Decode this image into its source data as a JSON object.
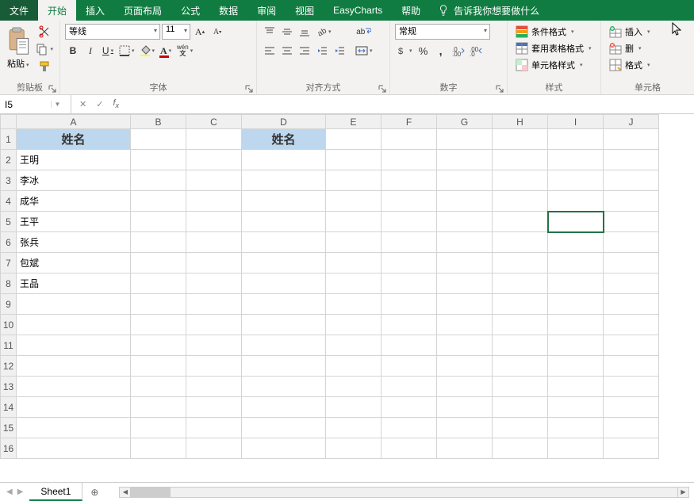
{
  "menu": {
    "file": "文件",
    "home": "开始",
    "insert": "插入",
    "layout": "页面布局",
    "formulas": "公式",
    "data": "数据",
    "review": "审阅",
    "view": "视图",
    "easycharts": "EasyCharts",
    "help": "帮助",
    "tellme": "告诉我你想要做什么"
  },
  "ribbon": {
    "clipboard": {
      "paste": "粘贴",
      "label": "剪贴板"
    },
    "font": {
      "name": "等线",
      "size": "11",
      "label": "字体",
      "bold": "B",
      "italic": "I",
      "underline": "U",
      "pinyin": "wén"
    },
    "align": {
      "label": "对齐方式",
      "wrap": "ab"
    },
    "number": {
      "format": "常规",
      "label": "数字"
    },
    "styles": {
      "cond": "条件格式",
      "table": "套用表格格式",
      "cell": "单元格样式",
      "label": "样式"
    },
    "cells": {
      "insert": "插入",
      "delete": "删",
      "format": "格式",
      "label": "单元格"
    }
  },
  "formula_bar": {
    "name": "I5",
    "value": ""
  },
  "columns": [
    "A",
    "B",
    "C",
    "D",
    "E",
    "F",
    "G",
    "H",
    "I",
    "J"
  ],
  "rows": [
    1,
    2,
    3,
    4,
    5,
    6,
    7,
    8,
    9,
    10,
    11,
    12,
    13,
    14,
    15,
    16
  ],
  "cells": {
    "A1": "姓名",
    "D1": "姓名",
    "A2": "王明",
    "A3": "李冰",
    "A4": "成华",
    "A5": "王平",
    "A6": "张兵",
    "A7": "包斌",
    "A8": "王品"
  },
  "active_cell": "I5",
  "sheets": {
    "active": "Sheet1"
  }
}
